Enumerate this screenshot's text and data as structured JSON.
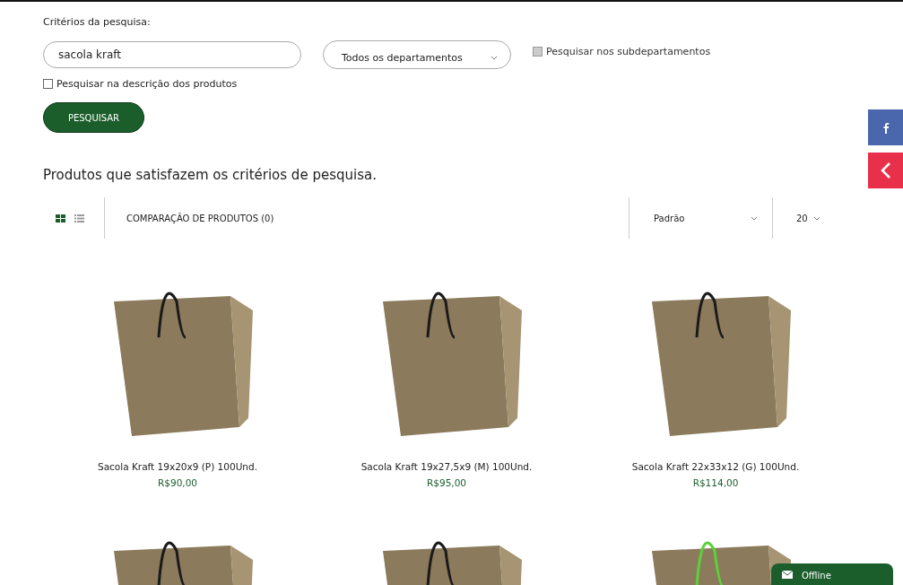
{
  "search": {
    "label": "Critérios da pesquisa:",
    "query": "sacola kraft",
    "department": "Todos os departamentos",
    "subdepartments": {
      "label": "Pesquisar nos subdepartamentos",
      "checked": false,
      "disabled": true
    },
    "description": {
      "label": "Pesquisar na descrição dos produtos",
      "checked": false,
      "disabled": false
    },
    "button": "PESQUISAR"
  },
  "results_title": "Produtos que satisfazem os critérios de pesquisa.",
  "toolbar": {
    "view_modes": [
      {
        "kind": "grid",
        "selected": true
      },
      {
        "kind": "list",
        "selected": false
      }
    ],
    "compare": "COMPARAÇÃO DE PRODUTOS (0)",
    "sort": "Padrão",
    "per_page": "20"
  },
  "products": [
    {
      "kind": "full",
      "name": "Sacola Kraft 19x20x9 (P) 100Und.",
      "price": "R$90,00"
    },
    {
      "kind": "full",
      "name": "Sacola Kraft 19x27,5x9 (M) 100Und.",
      "price": "R$95,00"
    },
    {
      "kind": "full",
      "name": "Sacola Kraft 22x33x12 (G) 100Und.",
      "price": "R$114,00"
    },
    {
      "kind": "cut"
    },
    {
      "kind": "cut"
    },
    {
      "kind": "cut"
    }
  ],
  "chat": {
    "label": "Offline"
  }
}
